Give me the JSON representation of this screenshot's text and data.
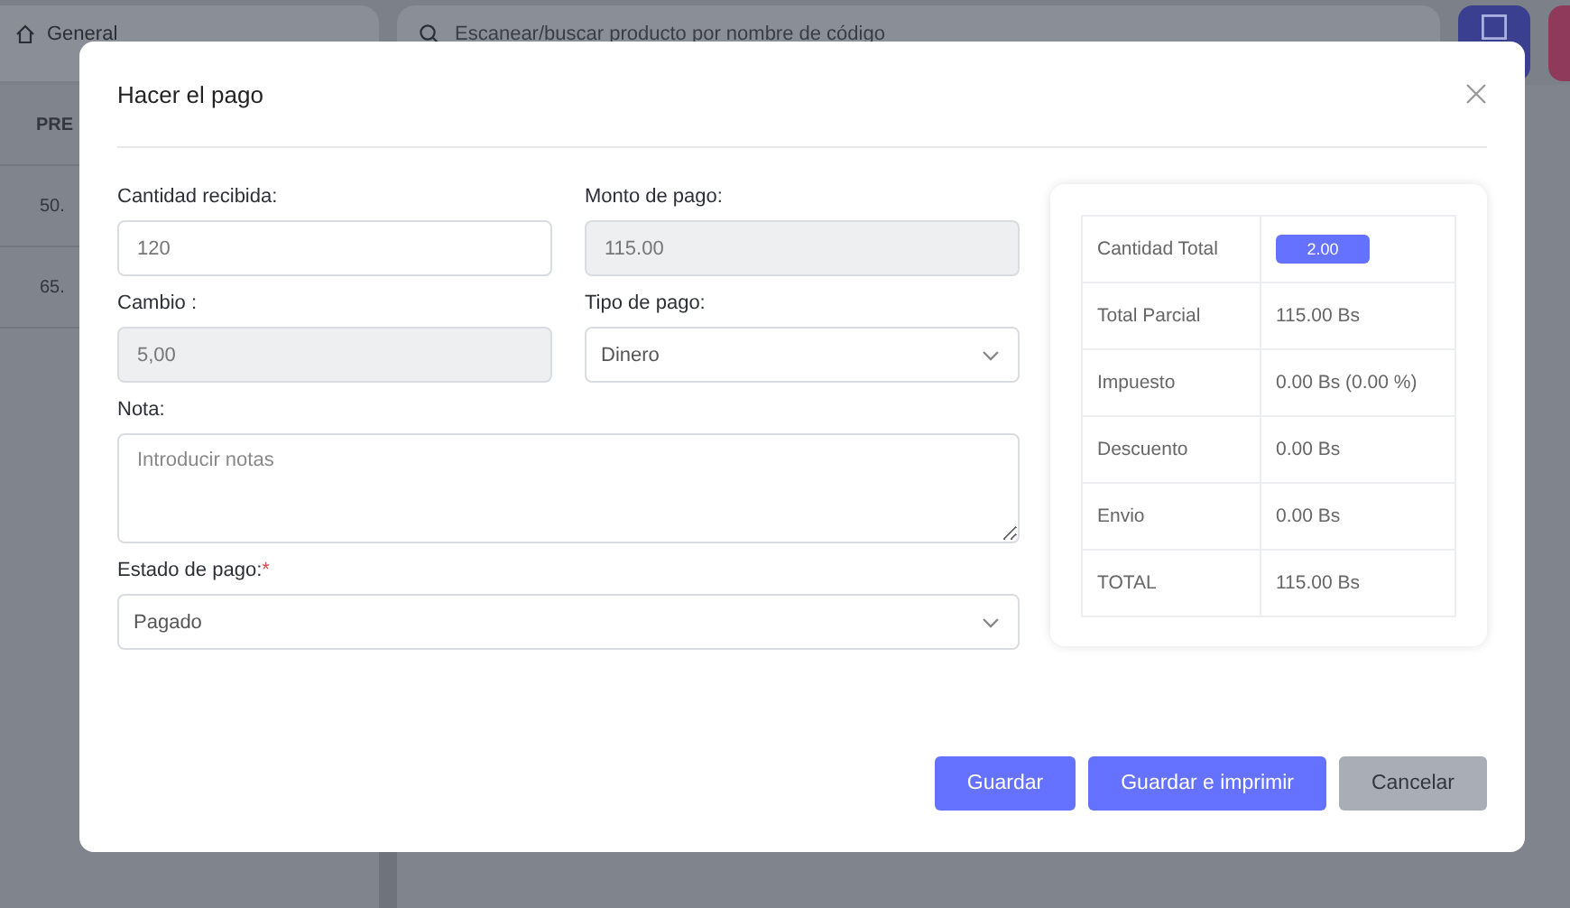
{
  "background": {
    "location": "General",
    "search": {
      "placeholder": "Escanear/buscar producto por nombre de código"
    },
    "table": {
      "columns": [
        "PRE"
      ],
      "rows": [
        [
          "50."
        ],
        [
          "65."
        ]
      ]
    }
  },
  "modal": {
    "title": "Hacer el pago",
    "fields": [
      {
        "label": "Cantidad recibida:",
        "kind": "input",
        "value": "120",
        "wide": false
      },
      {
        "label": "Monto de pago:",
        "kind": "readonly",
        "value": "115.00",
        "wide": false
      },
      {
        "label": "Cambio :",
        "kind": "readonly",
        "value": "5,00",
        "wide": false
      },
      {
        "label": "Tipo de pago:",
        "kind": "select",
        "value": "Dinero",
        "wide": false
      },
      {
        "label": "Nota:",
        "kind": "textarea",
        "placeholder": "Introducir notas",
        "wide": true
      },
      {
        "label": "Estado de pago:",
        "mark": "*",
        "kind": "select",
        "value": "Pagado",
        "wide": true
      }
    ],
    "summary": [
      {
        "label": "Cantidad Total",
        "value": "2.00",
        "kind": "badge"
      },
      {
        "label": "Total Parcial",
        "value": "115.00 Bs",
        "kind": "text"
      },
      {
        "label": "Impuesto",
        "value": "0.00 Bs (0.00 %)",
        "kind": "text"
      },
      {
        "label": "Descuento",
        "value": "0.00 Bs",
        "kind": "text"
      },
      {
        "label": "Envio",
        "value": "0.00 Bs",
        "kind": "text"
      },
      {
        "label": "TOTAL",
        "value": "115.00 Bs",
        "kind": "text"
      }
    ],
    "buttons": [
      {
        "label": "Guardar",
        "kind": "primary"
      },
      {
        "label": "Guardar e imprimir",
        "kind": "primary"
      },
      {
        "label": "Cancelar",
        "kind": "secondary"
      }
    ]
  }
}
